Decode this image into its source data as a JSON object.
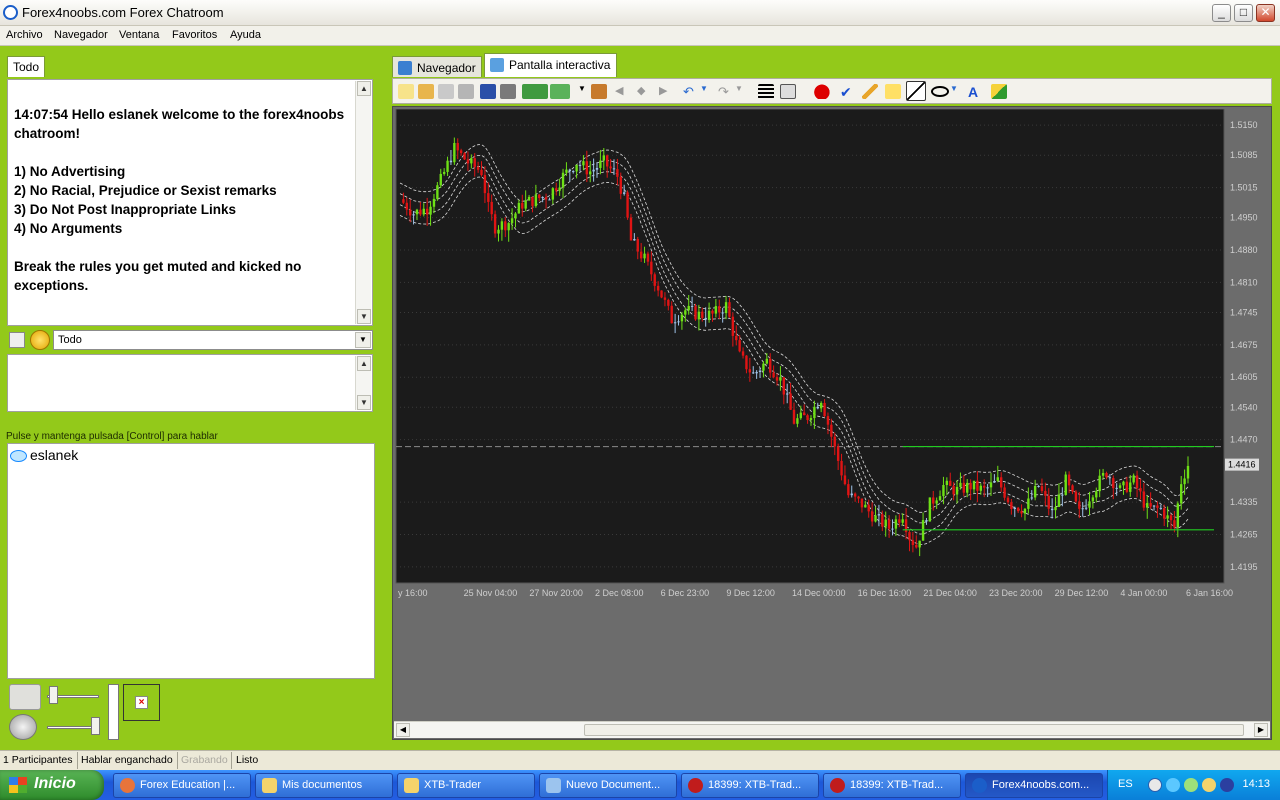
{
  "window": {
    "title": "Forex4noobs.com Forex Chatroom",
    "buttons": {
      "minimize": "_",
      "maximize": "□",
      "close": "✕"
    }
  },
  "menu": [
    "Archivo",
    "Navegador",
    "Ventana",
    "Favoritos",
    "Ayuda"
  ],
  "chat": {
    "tab": "Todo",
    "welcome": "14:07:54 Hello eslanek welcome to the forex4noobs chatroom!\n\n1) No Advertising\n2) No Racial, Prejudice or Sexist remarks\n3) Do Not Post Inappropriate Links\n4) No Arguments\n\nBreak the rules you get muted and kicked no exceptions.",
    "channel_select": "Todo",
    "hint": "Pulse y mantenga pulsada [Control] para hablar",
    "users": [
      "eslanek"
    ]
  },
  "statusbar": {
    "participants": "1 Participantes",
    "talking": "Hablar enganchado",
    "recording": "Grabando",
    "ready": "Listo"
  },
  "right": {
    "tabs": [
      "Navegador",
      "Pantalla interactiva"
    ],
    "active_tab": "Pantalla interactiva"
  },
  "chart_data": {
    "type": "candlestick",
    "y_ticks": [
      1.515,
      1.5085,
      1.5015,
      1.495,
      1.488,
      1.481,
      1.4745,
      1.4675,
      1.4605,
      1.454,
      1.447,
      1.4335,
      1.4265,
      1.4195
    ],
    "y_tick_labels": [
      "1.5150",
      "1.5085",
      "1.5015",
      "1.4950",
      "1.4880",
      "1.4810",
      "1.4745",
      "1.4675",
      "1.4605",
      "1.4540",
      "1.4470",
      "1.4335",
      "1.4265",
      "1.4195"
    ],
    "ylim": [
      1.416,
      1.5185
    ],
    "current_price_label": "1.4416",
    "current_price": 1.4416,
    "x_tick_labels": [
      "y 16:00",
      "25 Nov 04:00",
      "27 Nov 20:00",
      "2 Dec 08:00",
      "6 Dec 23:00",
      "9 Dec 12:00",
      "14 Dec 00:00",
      "16 Dec 16:00",
      "21 Dec 04:00",
      "23 Dec 20:00",
      "29 Dec 12:00",
      "4 Jan 00:00",
      "6 Jan 16:00"
    ],
    "range_lines": {
      "upper": 1.4455,
      "lower": 1.4275
    },
    "dashed_level": 1.4455,
    "trend_path": [
      [
        0,
        1.499
      ],
      [
        4,
        1.496
      ],
      [
        8,
        1.497
      ],
      [
        12,
        1.503
      ],
      [
        16,
        1.51
      ],
      [
        20,
        1.507
      ],
      [
        24,
        1.505
      ],
      [
        26,
        1.497
      ],
      [
        28,
        1.493
      ],
      [
        32,
        1.494
      ],
      [
        36,
        1.498
      ],
      [
        40,
        1.499
      ],
      [
        44,
        1.5
      ],
      [
        48,
        1.504
      ],
      [
        52,
        1.507
      ],
      [
        56,
        1.505
      ],
      [
        60,
        1.507
      ],
      [
        64,
        1.504
      ],
      [
        66,
        1.499
      ],
      [
        68,
        1.49
      ],
      [
        72,
        1.486
      ],
      [
        76,
        1.48
      ],
      [
        80,
        1.473
      ],
      [
        84,
        1.475
      ],
      [
        88,
        1.474
      ],
      [
        92,
        1.474
      ],
      [
        96,
        1.476
      ],
      [
        100,
        1.465
      ],
      [
        104,
        1.461
      ],
      [
        108,
        1.464
      ],
      [
        112,
        1.46
      ],
      [
        116,
        1.451
      ],
      [
        120,
        1.452
      ],
      [
        124,
        1.456
      ],
      [
        128,
        1.445
      ],
      [
        132,
        1.435
      ],
      [
        136,
        1.433
      ],
      [
        140,
        1.43
      ],
      [
        144,
        1.428
      ],
      [
        148,
        1.431
      ],
      [
        150,
        1.426
      ],
      [
        152,
        1.424
      ],
      [
        156,
        1.433
      ],
      [
        160,
        1.437
      ],
      [
        164,
        1.436
      ],
      [
        168,
        1.437
      ],
      [
        172,
        1.436
      ],
      [
        176,
        1.438
      ],
      [
        180,
        1.433
      ],
      [
        184,
        1.432
      ],
      [
        188,
        1.437
      ],
      [
        192,
        1.431
      ],
      [
        196,
        1.438
      ],
      [
        200,
        1.431
      ],
      [
        204,
        1.436
      ],
      [
        208,
        1.44
      ],
      [
        212,
        1.436
      ],
      [
        216,
        1.438
      ],
      [
        220,
        1.432
      ],
      [
        224,
        1.432
      ],
      [
        228,
        1.428
      ],
      [
        230,
        1.438
      ],
      [
        232,
        1.4416
      ]
    ],
    "colors": {
      "up": "#6ee016",
      "down": "#e01414",
      "neutral": "#9fc2e8",
      "band": "#dcdcdc",
      "range": "#22cc22",
      "bg": "#1b1b1b",
      "grid": "#3a3a3a"
    }
  }
}
